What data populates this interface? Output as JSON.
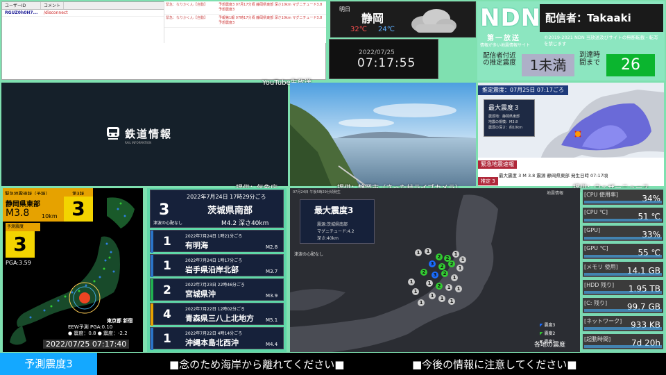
{
  "comments": {
    "col_user": "ユーザーID",
    "col_comment": "コメント",
    "rows": [
      {
        "user": "RGUZ0h0H7...",
        "comment": "/disconnect"
      }
    ]
  },
  "feed": [
    {
      "tag": "緊急：なりかくん【自動】",
      "msg": "予想震度3 07月17分頃 静岡県東部 深さ10km マグニチュード3.8 予想震度3"
    },
    {
      "tag": "緊急：なりかくん【自動】",
      "msg": "予報第1報 07時17分頃 静岡県東部 深さ10km マグニチュード3.8 予想震度3"
    }
  ],
  "weather": {
    "label": "明日",
    "city": "静岡",
    "high": "32℃",
    "low": "24℃"
  },
  "clock": {
    "date": "2022/07/25",
    "time": "07:17:55"
  },
  "ndn": {
    "logo": "NDN",
    "host": "配信者：Takaaki",
    "channel": "第一放送",
    "subtitle": "情報が多い地震情報サイト",
    "copyright": "©2019-2021 NDN 当放送及びサイトの無断転載・転写を禁じます",
    "local_label": "配信者付近の推定震度",
    "local_value": "1未満",
    "arrival_label": "到達時間まで",
    "arrival_seconds": "26"
  },
  "youtube_label": "YouTube生放送",
  "tetsudo": {
    "title": "鉄道情報",
    "sub": "RAIL INFORMATION"
  },
  "sources": {
    "tetsudo": "提供：気象庁",
    "camera": "提供：静岡市（さった峠ライブカメラ）",
    "eew": "提供：ウェザーニュース"
  },
  "eew_map": {
    "estimate": "推定震度：07月25日 07:17ごろ",
    "max_label": "最大震度３",
    "lines": [
      "震源地：静岡県東部",
      "地震の規模：M3.8",
      "震源の深さ：約10km"
    ],
    "red_title": "緊急地震速報",
    "info": "最大震度 3   M 3.8   震源 静岡県東部   発生日時 07:17頃",
    "yotei": "推定 3"
  },
  "kyoshin": {
    "header_a": "緊急地震速報（予報）",
    "header_b": "第3報",
    "epicenter": "静岡県東部",
    "mag": "M3.8",
    "depth": "10km",
    "shindo": "3",
    "yosoku_label": "予測震度",
    "yosoku": "3",
    "pga": "PGA:3.59",
    "legend": [
      "EEW予測  PGA:0.10",
      "● 震度：0.8  ● 震度：-2.2"
    ],
    "station": "東京都 新宿",
    "datetime": "2022/07/25 07:17:40"
  },
  "eq_top": {
    "datetime": "2022年7月24日 17時29分ごろ",
    "shindo": "3",
    "place": "茨城県南部",
    "tsunami": "津波の心配なし",
    "mag": "M4.2 深さ40km"
  },
  "eq_list": [
    {
      "dt": "2022年7月24日 1時21分ごろ",
      "shindo": "1",
      "place": "有明海",
      "mag": "M2.8",
      "color": "#2a74c8"
    },
    {
      "dt": "2022年7月24日 1時17分ごろ",
      "shindo": "1",
      "place": "岩手県沿岸北部",
      "mag": "M3.7",
      "color": "#2a74c8"
    },
    {
      "dt": "2022年7月23日 22時46分ごろ",
      "shindo": "2",
      "place": "宮城県沖",
      "mag": "M3.9",
      "color": "#20b050"
    },
    {
      "dt": "2022年7月22日 12時02分ごろ",
      "shindo": "4",
      "place": "青森県三八上北地方",
      "mag": "M5.1",
      "color": "#e6a200"
    },
    {
      "dt": "2022年7月22日 4時14分ごろ",
      "shindo": "1",
      "place": "沖縄本島北西沖",
      "mag": "M4.4",
      "color": "#2a74c8"
    }
  ],
  "big_map": {
    "title": "最大震度3",
    "lines": [
      "震源:茨城県南部",
      "マグニチュード:4.2",
      "深さ:40km"
    ],
    "tsunami": "津波の心配なし",
    "top_left": "07月24日 午後5時29分頃発生",
    "top_right": "地震情報",
    "legend": [
      "震度3",
      "震度2",
      "震度1"
    ],
    "caption": "各地の震度"
  },
  "stats": [
    {
      "label": "[CPU 使用率]",
      "value": "34%"
    },
    {
      "label": "[CPU ℃]",
      "value": "51 ℃"
    },
    {
      "label": "[GPU]",
      "value": "33%"
    },
    {
      "label": "[GPU ℃]",
      "value": "55 ℃"
    },
    {
      "label": "[メモリ 使用]",
      "value": "14.1 GB"
    },
    {
      "label": "[HDD 残り]",
      "value": "1.95 TB"
    },
    {
      "label": "[C: 残り]",
      "value": "99.7 GB"
    },
    {
      "label": "[ネットワーク]",
      "value": "933 KB"
    },
    {
      "label": "[起動時間]",
      "value": "7d 20h"
    }
  ],
  "bottom": {
    "predicted": "予測震度3",
    "msg1": "■念のため海岸から離れてください■",
    "msg2": "■今後の情報に注意してください■"
  }
}
